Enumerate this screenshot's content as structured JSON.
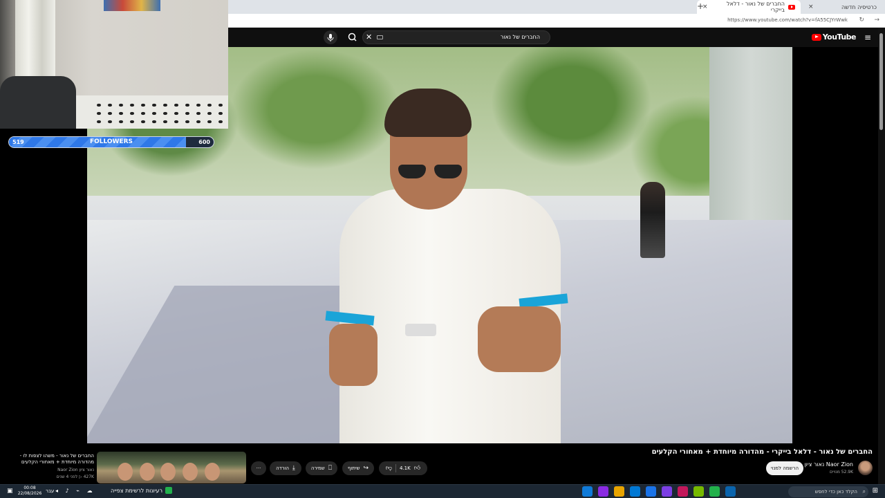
{
  "browser": {
    "tabs": [
      {
        "title": "החברים של נאור - דלאל בייקרי",
        "active": true
      },
      {
        "title": "כרטיסיה חדשה",
        "active": false
      }
    ],
    "new_tab_symbol": "+",
    "close_symbol": "×",
    "url": "https://www.youtube.com/watch?v=fA55CJYrWwk"
  },
  "youtube": {
    "logo_text": "YouTube",
    "search_query": "החברים של נאור",
    "clear_symbol": "✕",
    "video_title": "החברים של נאור - דלאל בייקרי - מהדורה מיוחדת + מאחורי הקלעים",
    "channel_name": "Naor Zion נאור ציון",
    "channel_subs": "52.9K מנויים",
    "subscribe_label": "הרשמה למנוי",
    "like_count": "4.1K",
    "share_label": "שיתוף",
    "save_label": "שמירה",
    "download_label": "הורדה",
    "more_symbol": "···"
  },
  "suggested": {
    "title": "החברים של נאור - משהו לצפות לו - מהדורה מיוחדת + מאחורי הקלעים",
    "channel": "נאור ציון Naor Zion",
    "meta": "427K ▷  לפני 4 שנים"
  },
  "overlay": {
    "followers_label": "FOLLOWERS",
    "followers_current": "519",
    "followers_goal": "600",
    "followers_progress": 0.865
  },
  "taskbar": {
    "search_placeholder": "הקלד כאן כדי לחפש",
    "widget_label": "רעיונות לרשימת צפייה",
    "time": "00:08",
    "date": "22/08/2026",
    "lang": "עבר",
    "app_colors": [
      "#0a64ad",
      "#22b14c",
      "#76b900",
      "#c2185b",
      "#7b3fe4",
      "#1a73e8",
      "#0078d4",
      "#e8a400",
      "#8a2be2",
      "#0f7ad8"
    ]
  },
  "colors": {
    "youtube_red": "#ff0000",
    "accent_blue": "#2f78e8",
    "sleeve_blue": "#1aa4d8"
  }
}
